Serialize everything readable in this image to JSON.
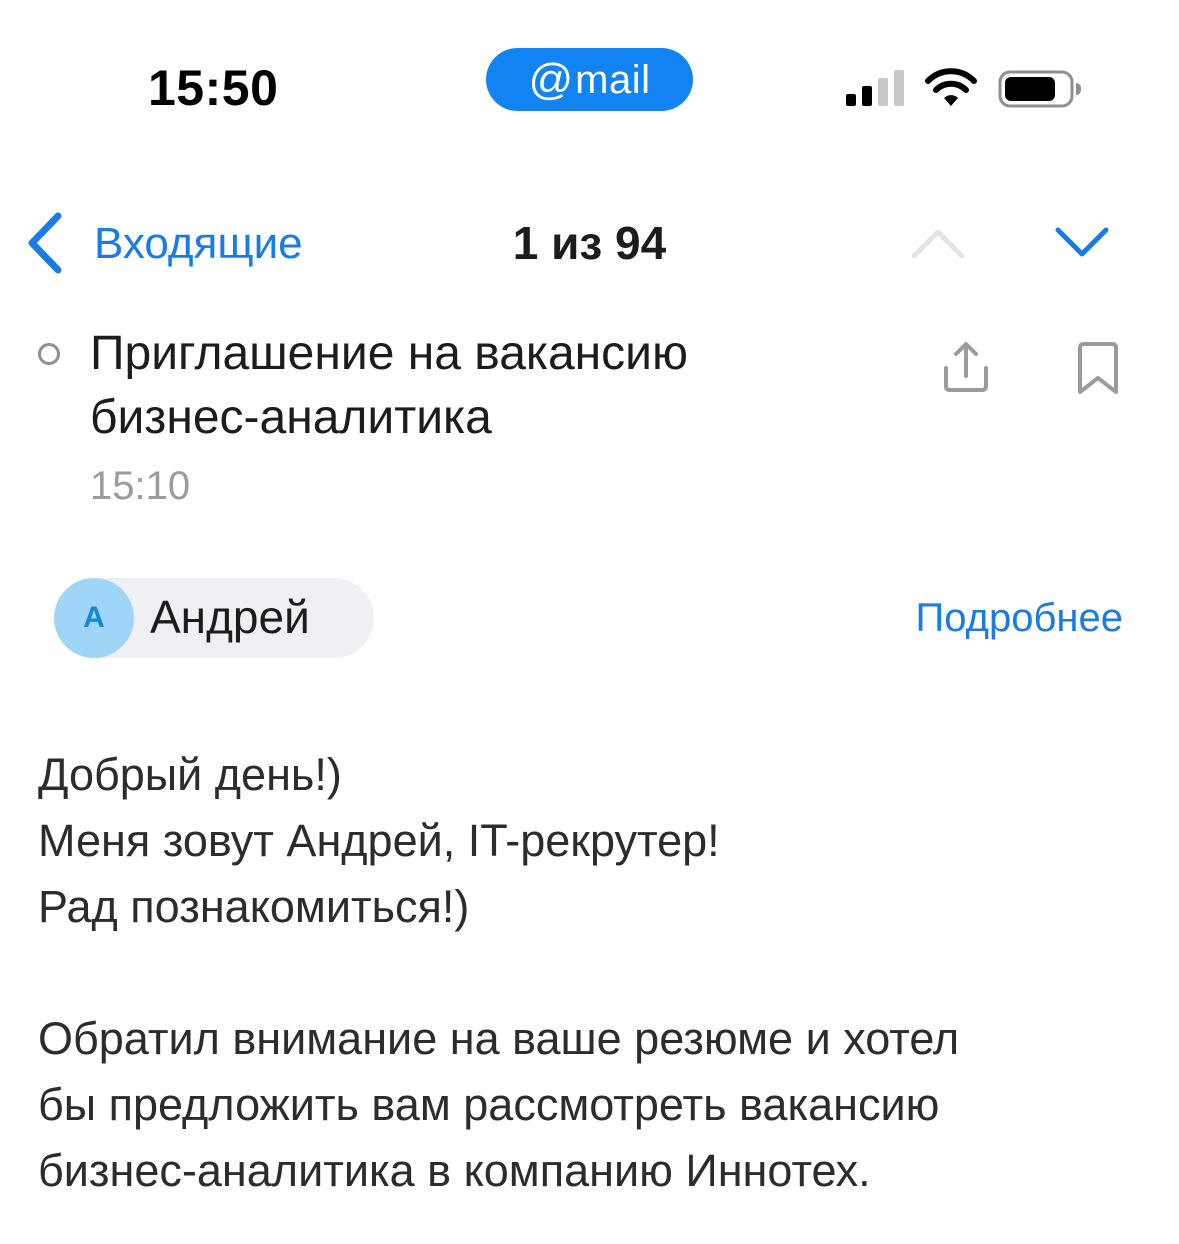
{
  "status_bar": {
    "time": "15:50",
    "island_at": "@",
    "island_text": "mail"
  },
  "nav": {
    "back_label": "Входящие",
    "counter": "1 из 94",
    "prev_icon": "chevron-up-icon",
    "next_icon": "chevron-down-icon"
  },
  "message": {
    "subject": "Приглашение на вакансию бизнес-аналитика",
    "time": "15:10",
    "sender_initial": "А",
    "sender_name": "Андрей",
    "details_link": "Подробнее",
    "body_p1": [
      "Добрый день!)",
      "Меня зовут Андрей, IT-рекрутер!",
      "Рад познакомиться!)"
    ],
    "body_p2": [
      "Обратил внимание на ваше резюме и хотел",
      "бы предложить вам рассмотреть вакансию",
      "бизнес-аналитика в компанию Иннотех."
    ]
  },
  "colors": {
    "accent": "#1a7ae6",
    "island": "#1183f2",
    "avatar_bg": "#9fd6f7",
    "chip_bg": "#eef0f3",
    "muted": "#9a9aa0"
  }
}
